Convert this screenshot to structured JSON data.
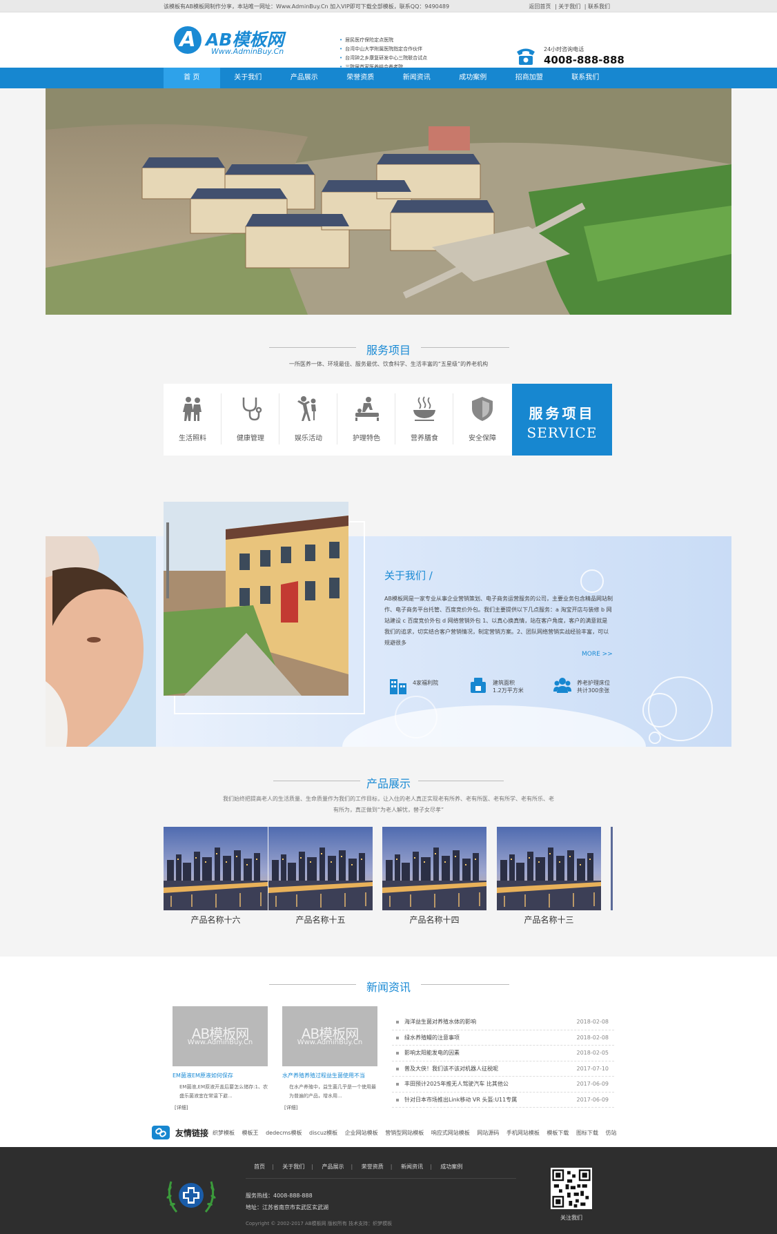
{
  "topbar": {
    "notice": "该模板有AB模板网制作分享，本站唯一网址：Www.AdminBuy.Cn 加入VIP即可下载全部模板，联系QQ：9490489",
    "links": [
      "返回首页",
      "|",
      "关于我们",
      "|",
      "联系我们"
    ]
  },
  "header": {
    "logo_text": "AB模板网",
    "logo_url": "Www.AdminBuy.Cn",
    "news": [
      "居民医疗保险定点医院",
      "台湾中山大学附属医院指定合作伙伴",
      "台湾钟之乡康复研发中心三院联合试点",
      "三院居首家医养结合养老院"
    ],
    "tel_label": "24小时咨询电话",
    "tel_number": "4008-888-888"
  },
  "nav": [
    "首 页",
    "关于我们",
    "产品展示",
    "荣誉资质",
    "新闻资讯",
    "成功案例",
    "招商加盟",
    "联系我们"
  ],
  "service": {
    "title": "服务项目",
    "subtitle": "一所医养一体、环境最佳、服务最优、饮食科学、生活丰富的“五星级”的养老机构",
    "items": [
      {
        "label": "生活照料",
        "icon": "elderly-walking-icon"
      },
      {
        "label": "健康管理",
        "icon": "stethoscope-icon"
      },
      {
        "label": "娱乐活动",
        "icon": "dancing-icon"
      },
      {
        "label": "护理特色",
        "icon": "nursing-icon"
      },
      {
        "label": "营养膳食",
        "icon": "food-bowl-icon"
      },
      {
        "label": "安全保障",
        "icon": "shield-icon"
      }
    ],
    "banner_cn": "服务项目",
    "banner_en": "SERVICE"
  },
  "about": {
    "title": "关于我们 /",
    "text": "AB模板网是一家专业从事企业营销策划、电子商务运营服务的公司，主要业务包含精品网站制作、电子商务平台托管、百度竞价外包。我们主要提供以下几点服务：a 淘宝开店与装修 b 网站建设 c 百度竞价外包 d 网络营销外包 1、以真心换真情，站在客户角度，客户的满意就是我们的追求，切实结合客户营销情况，制定营销方案。2、团队网络营销实战经验丰富，可以规避很多",
    "more": "MORE >>",
    "stats": [
      {
        "line1": "4家福利院",
        "line2": "",
        "icon": "building-icon"
      },
      {
        "line1": "建筑面积",
        "line2": "1.2万平方米",
        "icon": "area-icon"
      },
      {
        "line1": "养老护理床位",
        "line2": "共计300余张",
        "icon": "people-icon"
      }
    ]
  },
  "products": {
    "title": "产品展示",
    "desc": "我们始终把提高老人的生活质量、生命质量作为我们的工作目标，让入住的老人真正实现老有所养、老有所医、老有所学、老有所乐、老有所为，真正做到“为老人解忧，替子女尽孝”",
    "items": [
      "产品名称十六",
      "产品名称十五",
      "产品名称十四",
      "产品名称十三"
    ]
  },
  "news": {
    "title": "新闻资讯",
    "cards": [
      {
        "img_a": "AB模板网",
        "img_b": "Www.AdminBuy.Cn",
        "title": "EM菌液EM原液如何保存",
        "desc": "EM菌液,EM原液开盖后要怎么储存:1、农盛乐菌液宜在常温下避...",
        "more": "[详细]"
      },
      {
        "img_a": "AB模板网",
        "img_b": "Www.AdminBuy.Cn",
        "title": "水产养殖养殖过程益生菌使用不当",
        "desc": "在水产养殖中，益生菌几乎是一个使用最为普遍的产品，增水用...",
        "more": "[详细]"
      }
    ],
    "list": [
      {
        "title": "海洋益生菌对养殖水体的影响",
        "date": "2018-02-08"
      },
      {
        "title": "绿水养殖鳗的注意事项",
        "date": "2018-02-08"
      },
      {
        "title": "影响太阳能发电的因素",
        "date": "2018-02-05"
      },
      {
        "title": "普及大侠！我们该不该对机器人征税呢",
        "date": "2017-07-10"
      },
      {
        "title": "丰田预计2025年推无人驾驶汽车 比其他公",
        "date": "2017-06-09"
      },
      {
        "title": "针对日本市场推出Link移动 VR 头盔:U11专属",
        "date": "2017-06-09"
      }
    ]
  },
  "friend_links": {
    "title": "友情链接",
    "items": [
      "织梦模板",
      "模板王",
      "dedecms模板",
      "discuz模板",
      "企业网站模板",
      "营销型网站模板",
      "响应式网站模板",
      "网站源码",
      "手机网站模板",
      "模板下载",
      "图标下载",
      "仿站"
    ]
  },
  "footer": {
    "nav": [
      "首页",
      "关于我们",
      "产品展示",
      "荣誉资质",
      "新闻资讯",
      "成功案例"
    ],
    "hotline": "服务热线：4008-888-888",
    "address": "地址：江苏省南京市玄武区玄武湖",
    "copyright": "Copyright © 2002-2017 AB模板网 版权所有 技术支持：织梦模板",
    "qr_label": "关注我们"
  },
  "colors": {
    "brand": "#1787d0",
    "nav_active": "#2ea2ea",
    "footer": "#2e2e2e"
  }
}
